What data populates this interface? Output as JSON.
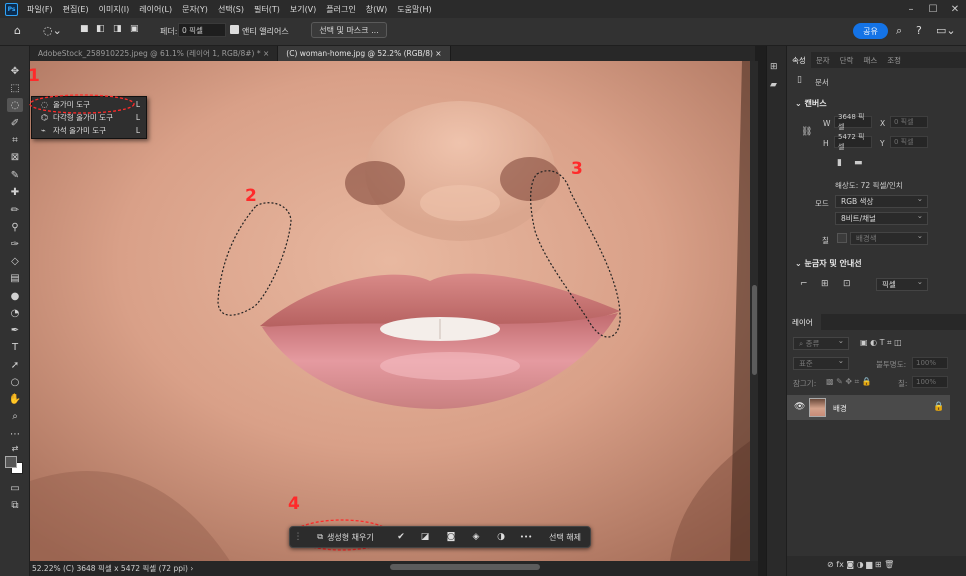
{
  "menu": [
    "파일(F)",
    "편집(E)",
    "이미지(I)",
    "레이어(L)",
    "문자(Y)",
    "선택(S)",
    "필터(T)",
    "보기(V)",
    "플러그인",
    "창(W)",
    "도움말(H)"
  ],
  "app_logo": "Ps",
  "window_controls": [
    "–",
    "☐",
    "✕"
  ],
  "options": {
    "feather_label": "페더:",
    "feather_value": "0 픽셀",
    "antialias_label": "앤티 앨리어스",
    "select_mask_label": "선택 및 마스크 ...",
    "share_label": "공유"
  },
  "tabs": [
    {
      "label": "AdobeStock_258910225.jpeg @ 61.1% (레이어 1, RGB/8#) *  ×"
    },
    {
      "label": "(C) woman-home.jpg @ 52.2% (RGB/8)  ×"
    }
  ],
  "flyout": {
    "items": [
      {
        "label": "올가미 도구",
        "shortcut": "L",
        "icon": "lasso-icon"
      },
      {
        "label": "다각형 올가미 도구",
        "shortcut": "L",
        "icon": "polygonal-lasso-icon"
      },
      {
        "label": "자석 올가미 도구",
        "shortcut": "L",
        "icon": "magnetic-lasso-icon"
      }
    ]
  },
  "annotations": [
    "1",
    "2",
    "3",
    "4"
  ],
  "taskbar": {
    "generative_fill_label": "생성형 채우기",
    "more_label": "•••",
    "deselect_label": "선택 해제"
  },
  "status": {
    "text": "52.22%  (C) 3648 픽셀 x 5472 픽셀 (72 ppi)  ›"
  },
  "properties": {
    "tabs": [
      "속성",
      "문자",
      "단락",
      "패스",
      "조정"
    ],
    "doc_label": "문서",
    "canvas_section": "캔버스",
    "w_label": "W",
    "w_value": "3648 픽셀",
    "x_label": "X",
    "x_value": "0 픽셀",
    "h_label": "H",
    "h_value": "5472 픽셀",
    "y_label": "Y",
    "y_value": "0 픽셀",
    "resolution": "해상도: 72 픽셀/인치",
    "mode_label": "모드",
    "mode_value": "RGB 색상",
    "depth_value": "8비트/채널",
    "fill_label": "칠",
    "fill_value": "배경색",
    "rulers_section": "눈금자 및 안내선",
    "unit_value": "픽셀"
  },
  "layers": {
    "tab_label": "레이어",
    "filter_label": "종류",
    "blend_mode": "표준",
    "opacity_label": "불투명도:",
    "opacity_value": "100%",
    "lock_label": "잠그기:",
    "fill_label": "칠:",
    "fill_value": "100%",
    "layer_name": "배경"
  },
  "colors": {
    "accent": "#1473e6",
    "annotation": "#ff2a2a"
  }
}
